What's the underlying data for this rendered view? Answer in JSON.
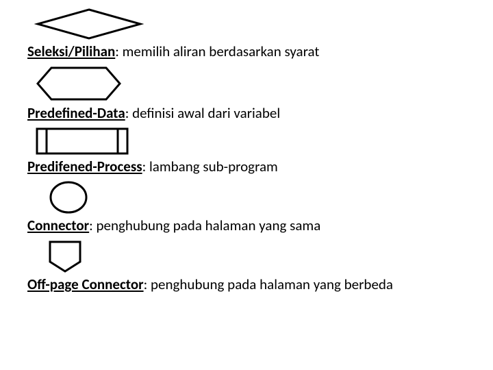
{
  "items": [
    {
      "term": "Seleksi/Pilihan",
      "sep": ": ",
      "desc": "memilih aliran berdasarkan syarat"
    },
    {
      "term": "Predefined-Data",
      "sep": ": ",
      "desc": "definisi awal dari variabel"
    },
    {
      "term": "Predifened-Process",
      "sep": ": ",
      "desc": "lambang sub-program"
    },
    {
      "term": "Connector",
      "sep": ": ",
      "desc": "penghubung pada halaman yang sama"
    },
    {
      "term": "Off-page Connector",
      "sep": ": ",
      "desc": "penghubung pada halaman yang  berbeda"
    }
  ]
}
